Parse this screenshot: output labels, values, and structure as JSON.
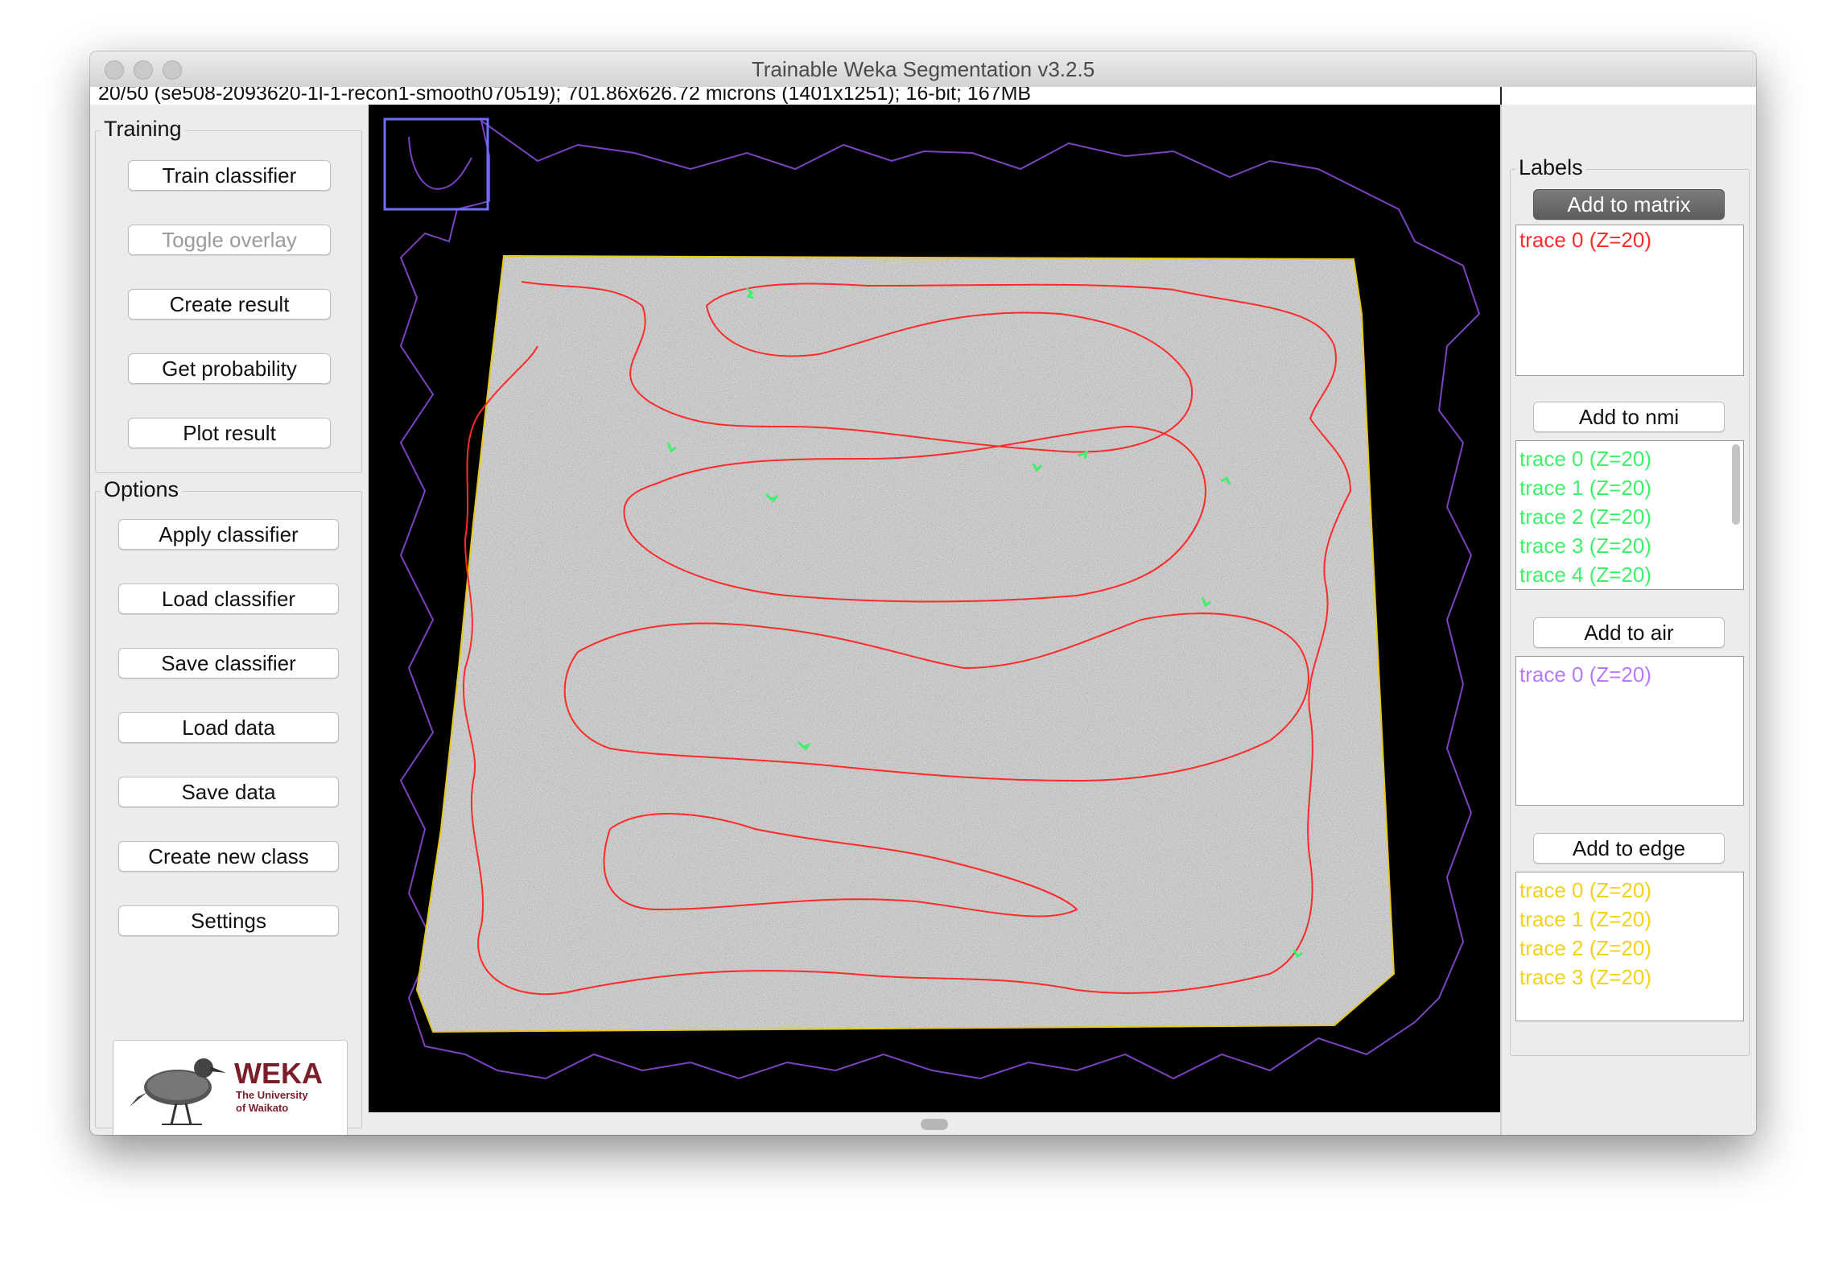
{
  "window": {
    "title": "Trainable Weka Segmentation v3.2.5",
    "info": "20/50 (se508-2093620-1l-1-recon1-smooth070519); 701.86x626.72 microns (1401x1251); 16-bit; 167MB"
  },
  "training": {
    "title": "Training",
    "buttons": [
      "Train classifier",
      "Toggle overlay",
      "Create result",
      "Get probability",
      "Plot result"
    ]
  },
  "options": {
    "title": "Options",
    "buttons": [
      "Apply classifier",
      "Load classifier",
      "Save classifier",
      "Load data",
      "Save data",
      "Create new class",
      "Settings"
    ]
  },
  "logo": {
    "name": "WEKA",
    "subtitle_line1": "The University",
    "subtitle_line2": "of Waikato",
    "icon": "weka-bird-icon"
  },
  "labels": {
    "title": "Labels",
    "classes": [
      {
        "button": "Add to matrix",
        "color": "#ff2a2a",
        "items": [
          "trace 0 (Z=20)"
        ]
      },
      {
        "button": "Add to nmi",
        "color": "#3ef06a",
        "items": [
          "trace 0 (Z=20)",
          "trace 1 (Z=20)",
          "trace 2 (Z=20)",
          "trace 3 (Z=20)",
          "trace 4 (Z=20)"
        ]
      },
      {
        "button": "Add to air",
        "color": "#b679ff",
        "items": [
          "trace 0 (Z=20)"
        ]
      },
      {
        "button": "Add to edge",
        "color": "#f2d21a",
        "items": [
          "trace 0 (Z=20)",
          "trace 1 (Z=20)",
          "trace 2 (Z=20)",
          "trace 3 (Z=20)"
        ]
      }
    ]
  },
  "overlay_colors": {
    "matrix": "#ff2a2a",
    "nmi": "#3ef06a",
    "air": "#8a4fd0",
    "edge": "#e6c81a",
    "zoom_box": "#6f6fff"
  }
}
